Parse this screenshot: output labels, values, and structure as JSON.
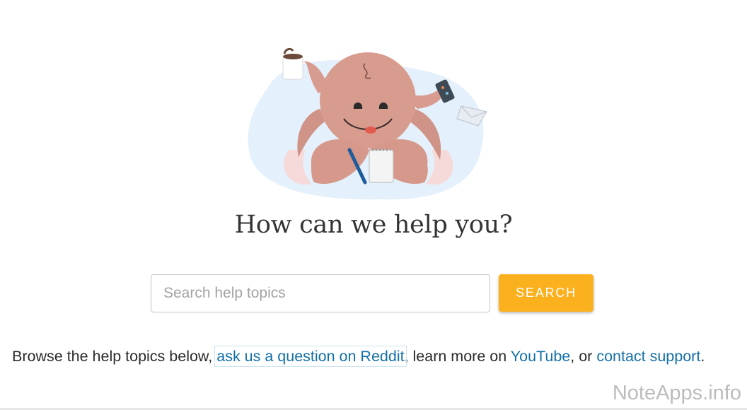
{
  "hero": {
    "illustration": "octopus-mascot"
  },
  "headline": "How can we help you?",
  "search": {
    "placeholder": "Search help topics",
    "value": "",
    "button_label": "SEARCH",
    "button_color": "#fbb01d"
  },
  "browse": {
    "prefix": "Browse the help topics below, ",
    "reddit_link": "ask us a question on Reddit",
    "middle": ", learn more on ",
    "youtube_link": "YouTube",
    "or_text": ", or ",
    "support_link": "contact support",
    "suffix": ".",
    "link_color": "#1470a8"
  },
  "watermark": "NoteApps.info"
}
